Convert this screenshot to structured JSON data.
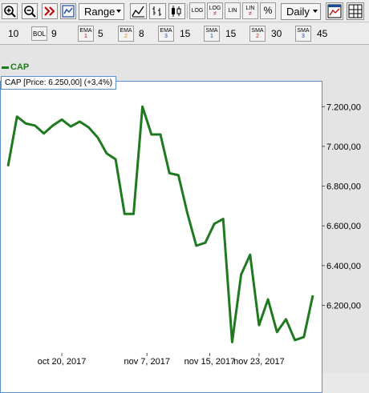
{
  "toolbar": {
    "range_label": "Range",
    "period_label": "Daily",
    "scale_buttons": [
      {
        "top": "LOG",
        "bottom": ""
      },
      {
        "top": "LOG",
        "bottom": "≠"
      },
      {
        "top": "LIN",
        "bottom": ""
      },
      {
        "top": "LIN",
        "bottom": "≠"
      },
      {
        "top": "%",
        "bottom": ""
      }
    ]
  },
  "indicators": {
    "period_first": "10",
    "bol_label": "BOL",
    "bol_value": "9",
    "ema1_label": "EMA",
    "ema1_sub": "1",
    "ema1_value": "5",
    "ema2_label": "EMA",
    "ema2_sub": "2",
    "ema2_value": "8",
    "ema3_label": "EMA",
    "ema3_sub": "3",
    "ema3_value": "15",
    "sma1_label": "SMA",
    "sma1_sub": "1",
    "sma1_value": "15",
    "sma2_label": "SMA",
    "sma2_sub": "2",
    "sma2_value": "30",
    "sma3_label": "SMA",
    "sma3_sub": "3",
    "sma3_value": "45"
  },
  "legend": {
    "series_name": "CAP"
  },
  "info": {
    "text": "CAP [Price: 6.250,00] (+3,4%)"
  },
  "colors": {
    "line": "#1f7a1f",
    "border": "#5a8ed0",
    "ema2": "#e08000",
    "sma2": "#cc2020"
  },
  "chart_data": {
    "type": "line",
    "series": [
      {
        "name": "CAP",
        "values": [
          6900,
          7150,
          7115,
          7105,
          7065,
          7105,
          7135,
          7100,
          7125,
          7095,
          7045,
          6965,
          6935,
          6660,
          6660,
          7200,
          7060,
          7060,
          6865,
          6855,
          6665,
          6500,
          6515,
          6610,
          6635,
          6015,
          6355,
          6455,
          6100,
          6230,
          6065,
          6130,
          6025,
          6040,
          6250
        ]
      }
    ],
    "yticks": [
      "7.200,00",
      "7.000,00",
      "6.800,00",
      "6.600,00",
      "6.400,00",
      "6.200,00"
    ],
    "yvalues": [
      7200,
      7000,
      6800,
      6600,
      6400,
      6200
    ],
    "ylim": [
      5960,
      7330
    ],
    "xtick_labels": [
      "oct 20, 2017",
      "nov 7, 2017",
      "nov 15, 2017",
      "nov 23, 2017"
    ],
    "xtick_index": [
      6.0,
      15.5,
      22.5,
      28.0
    ]
  }
}
